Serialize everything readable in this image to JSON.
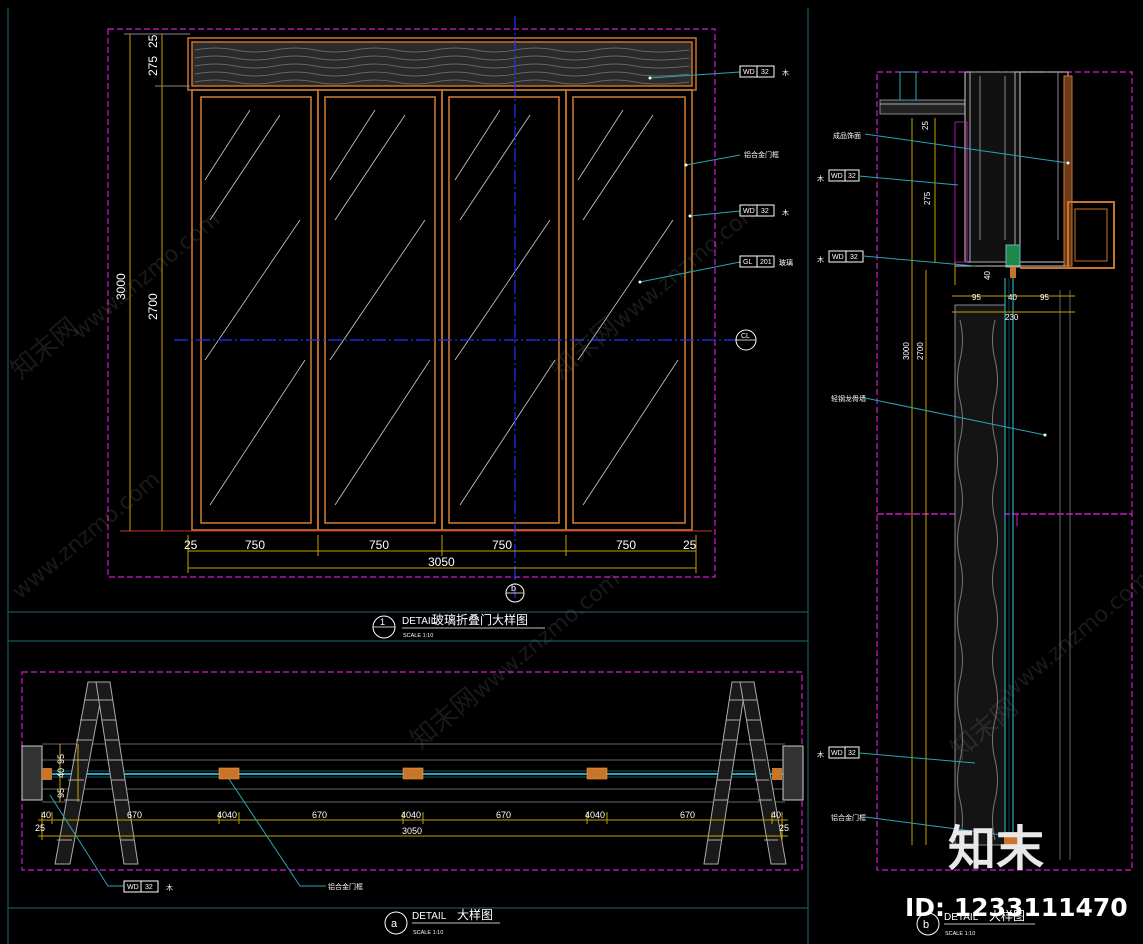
{
  "elevation": {
    "dims_vertical": [
      "3000",
      "2700",
      "275",
      "25"
    ],
    "dims_horizontal": [
      "25",
      "750",
      "750",
      "750",
      "750",
      "25"
    ],
    "total_width": "3050",
    "tags": [
      {
        "code": "WD",
        "num": "32",
        "note": "木"
      },
      {
        "code": "WD",
        "num": "32",
        "note": "木"
      },
      {
        "code": "GL",
        "num": "201",
        "note": "玻璃"
      }
    ],
    "leader_note": "铝合金门框",
    "section_mark": "b",
    "axis_mark": "CL"
  },
  "caption_1": {
    "num": "1",
    "title": "DETAIL",
    "cn": "玻璃折叠门大样图",
    "scale": "SCALE 1:10"
  },
  "plan": {
    "dims_left": [
      "95",
      "40",
      "95"
    ],
    "dims_segments": [
      "40",
      "670",
      "4040",
      "670",
      "4040",
      "670",
      "4040",
      "670",
      "40"
    ],
    "end_dims": [
      "25",
      "25"
    ],
    "total": "3050",
    "tag": {
      "code": "WD",
      "num": "32",
      "note": "木"
    },
    "leader_note": "铝合金门框"
  },
  "caption_a": {
    "letter": "a",
    "title": "DETAIL",
    "cn": "大样图",
    "scale": "SCALE 1:10"
  },
  "section": {
    "tags": [
      {
        "code": "WD",
        "num": "32",
        "note": "木"
      },
      {
        "code": "WD",
        "num": "32",
        "note": "木"
      },
      {
        "code": "WD",
        "num": "32",
        "note": "木"
      }
    ],
    "dims_top": [
      "25",
      "275",
      "40"
    ],
    "dims_plan": [
      "95",
      "40",
      "95"
    ],
    "dim_total": "230",
    "dims_height": [
      "3000",
      "2700"
    ],
    "notes": [
      "成品饰面",
      "轻钢龙骨墙",
      "铝合金门框"
    ]
  },
  "caption_b": {
    "letter": "b",
    "title": "DETAIL",
    "cn": "大样图",
    "scale": "SCALE 1:10"
  },
  "watermark": {
    "brand": "知末",
    "site": "www.znzmo.com",
    "brand_cn": "知末网",
    "id": "ID: 1233111470"
  },
  "colors": {
    "frame": "#c8752a",
    "magenta": "#d21ad2",
    "teal": "#2aa3b8",
    "blue": "#2233ff",
    "text": "#ffffff"
  }
}
